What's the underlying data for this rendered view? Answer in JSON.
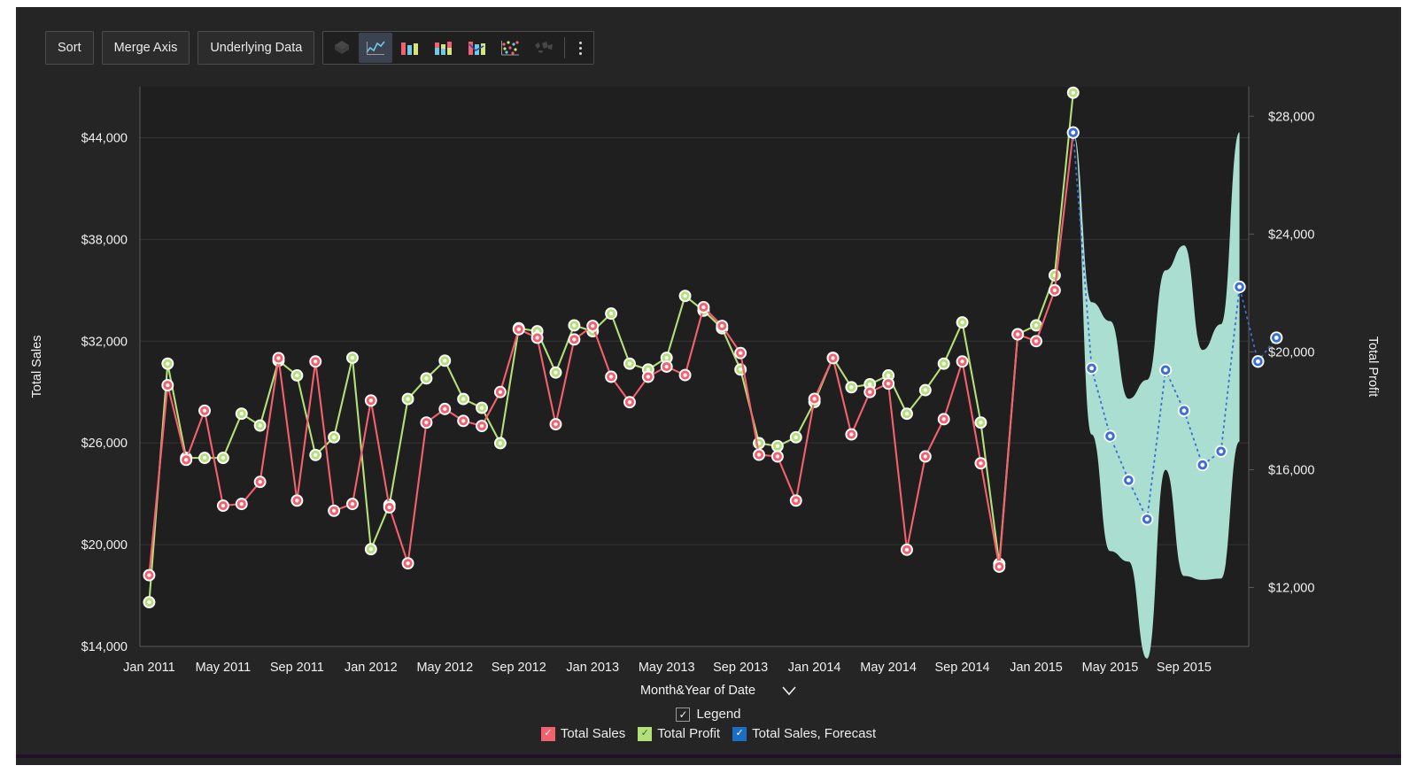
{
  "toolbar": {
    "buttons": [
      {
        "label": "Sort",
        "name": "sort-button"
      },
      {
        "label": "Merge Axis",
        "name": "merge-axis-button"
      },
      {
        "label": "Underlying Data",
        "name": "underlying-data-button"
      }
    ],
    "viz_icons": [
      {
        "name": "pie-chart-icon",
        "state": "dim"
      },
      {
        "name": "line-chart-icon",
        "state": "active"
      },
      {
        "name": "bar-chart-icon",
        "state": "normal"
      },
      {
        "name": "stacked-bar-chart-icon",
        "state": "normal"
      },
      {
        "name": "combo-chart-icon",
        "state": "normal"
      },
      {
        "name": "scatter-plot-icon",
        "state": "normal"
      },
      {
        "name": "map-chart-icon",
        "state": "dim"
      }
    ],
    "more_menu": "more-options-icon"
  },
  "axes": {
    "left": {
      "title": "Total Sales",
      "ticks": [
        "$14,000",
        "$20,000",
        "$26,000",
        "$32,000",
        "$38,000",
        "$44,000"
      ],
      "min": 14000,
      "max": 47000,
      "step": 6000
    },
    "right": {
      "title": "Total Profit",
      "ticks": [
        "$12,000",
        "$16,000",
        "$20,000",
        "$24,000",
        "$28,000"
      ],
      "min": 10000,
      "max": 29000,
      "step": 4000
    },
    "x": {
      "title": "Month&Year of Date",
      "dropdown_icon": "chevron-down-icon",
      "ticks": [
        "Jan 2011",
        "May 2011",
        "Sep 2011",
        "Jan 2012",
        "May 2012",
        "Sep 2012",
        "Jan 2013",
        "May 2013",
        "Sep 2013",
        "Jan 2014",
        "May 2014",
        "Sep 2014",
        "Jan 2015",
        "May 2015",
        "Sep 2015"
      ]
    }
  },
  "legend": {
    "header_label": "Legend",
    "header_checked": true,
    "items": [
      {
        "label": "Total Sales",
        "color": "#f4616e",
        "checked": true
      },
      {
        "label": "Total Profit",
        "color": "#b4e07a",
        "checked": true
      },
      {
        "label": "Total Sales, Forecast",
        "color": "#1a6fc4",
        "checked": true
      }
    ]
  },
  "colors": {
    "panel_bg": "#252525",
    "plot_bg": "#1f1f1f",
    "grid": "#3a3a3a",
    "sales": "#f4616e",
    "profit": "#b4e07a",
    "forecast": "#3b6fd4",
    "forecast_band": "#a9ded0",
    "text": "#ededed",
    "bottom_bar": "#20102a"
  },
  "chart_data": {
    "type": "line",
    "title": "",
    "xlabel": "Month&Year of Date",
    "ylabel": "Total Sales",
    "y2label": "Total Profit",
    "ylim": [
      14000,
      47000
    ],
    "y2lim": [
      10000,
      29000
    ],
    "grid": true,
    "legend_position": "bottom",
    "categories": [
      "Jan 2011",
      "Feb 2011",
      "Mar 2011",
      "Apr 2011",
      "May 2011",
      "Jun 2011",
      "Jul 2011",
      "Aug 2011",
      "Sep 2011",
      "Oct 2011",
      "Nov 2011",
      "Dec 2011",
      "Jan 2012",
      "Feb 2012",
      "Mar 2012",
      "Apr 2012",
      "May 2012",
      "Jun 2012",
      "Jul 2012",
      "Aug 2012",
      "Sep 2012",
      "Oct 2012",
      "Nov 2012",
      "Dec 2012",
      "Jan 2013",
      "Feb 2013",
      "Mar 2013",
      "Apr 2013",
      "May 2013",
      "Jun 2013",
      "Jul 2013",
      "Aug 2013",
      "Sep 2013",
      "Oct 2013",
      "Nov 2013",
      "Dec 2013",
      "Jan 2014",
      "Feb 2014",
      "Mar 2014",
      "Apr 2014",
      "May 2014",
      "Jun 2014",
      "Jul 2014",
      "Aug 2014",
      "Sep 2014",
      "Oct 2014",
      "Nov 2014",
      "Dec 2014",
      "Jan 2015",
      "Feb 2015",
      "Mar 2015",
      "Apr 2015",
      "May 2015",
      "Jun 2015",
      "Jul 2015",
      "Aug 2015",
      "Sep 2015",
      "Oct 2015",
      "Nov 2015",
      "Dec 2015"
    ],
    "series": [
      {
        "name": "Total Sales",
        "axis": "left",
        "color": "#f4616e",
        "values": [
          18200,
          29400,
          25000,
          27900,
          22300,
          22400,
          23700,
          31000,
          22600,
          30800,
          22000,
          22400,
          28500,
          22200,
          18900,
          27200,
          28000,
          27300,
          27000,
          29000,
          32700,
          32200,
          27100,
          32100,
          32900,
          29900,
          28400,
          29900,
          30500,
          30000,
          34000,
          32900,
          31300,
          25300,
          25200,
          22600,
          28600,
          31000,
          26500,
          29000,
          29500,
          19700,
          25200,
          27400,
          30800,
          24800,
          18700,
          32400,
          32000,
          35000,
          44300
        ]
      },
      {
        "name": "Total Profit",
        "axis": "right",
        "color": "#b4e07a",
        "values": [
          11500,
          19600,
          16400,
          16400,
          16400,
          17900,
          17500,
          19700,
          19200,
          16500,
          17100,
          19800,
          13300,
          14800,
          18400,
          19100,
          19700,
          18400,
          18100,
          16900,
          20800,
          20700,
          19300,
          20900,
          20700,
          21300,
          19600,
          19400,
          19800,
          21900,
          21400,
          20800,
          19400,
          16900,
          16800,
          17100,
          18300,
          19800,
          18800,
          18900,
          19200,
          17900,
          18700,
          19600,
          21000,
          17600,
          12800,
          20600,
          20900,
          22600,
          28800
        ]
      },
      {
        "name": "Total Sales, Forecast",
        "axis": "left",
        "color": "#3b6fd4",
        "dashed": true,
        "values": [
          null,
          null,
          null,
          null,
          null,
          null,
          null,
          null,
          null,
          null,
          null,
          null,
          null,
          null,
          null,
          null,
          null,
          null,
          null,
          null,
          null,
          null,
          null,
          null,
          null,
          null,
          null,
          null,
          null,
          null,
          null,
          null,
          null,
          null,
          null,
          null,
          null,
          null,
          null,
          null,
          null,
          null,
          null,
          null,
          null,
          null,
          null,
          null,
          null,
          null,
          44300,
          30400,
          26400,
          23800,
          21500,
          30300,
          27900,
          24700,
          25500,
          35200,
          30800,
          32200
        ],
        "band": {
          "name": "Forecast confidence interval",
          "color": "#a9ded0",
          "opacity": 1
        }
      }
    ]
  }
}
